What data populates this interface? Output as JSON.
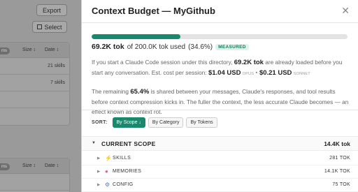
{
  "background": {
    "export_label": "Export",
    "select_label": "Select",
    "panels": [
      {
        "pill": "ms",
        "col_size": "Size ↕",
        "col_date": "Date ↕",
        "rows": [
          "21 skills",
          "7 skills",
          "",
          ""
        ]
      },
      {
        "pill": "ms",
        "col_size": "Size ↕",
        "col_date": "Date ↕",
        "rows": [
          ""
        ]
      }
    ]
  },
  "modal": {
    "title": "Context Budget — MyGithub",
    "close_icon": "close-icon",
    "usage": {
      "used": "69.2K tok",
      "of_text": "of 200.0K tok used",
      "percent_text": "(34.6%)",
      "fraction": 0.346,
      "badge": "MEASURED",
      "bar_color": "#18896c"
    },
    "para1": {
      "a": "If you start a Claude Code session under this directory,",
      "tok": "69.2K tok",
      "b": "are already loaded before you start any conversation. Est. cost per session:",
      "price_opus": "$1.04 USD",
      "opus_label": "OPUS",
      "dot": "·",
      "price_sonnet": "$0.21 USD",
      "sonnet_label": "SONNET"
    },
    "para2": {
      "a": "The remaining",
      "pct": "65.4%",
      "b": "is shared between your messages, Claude's responses, and tool results before context compression kicks in. The fuller the context, the less accurate Claude becomes — an effect known as context rot."
    },
    "sort": {
      "label": "SORT:",
      "options": [
        "By Scope ↓",
        "By Category",
        "By Tokens"
      ]
    },
    "scope": {
      "label": "CURRENT SCOPE",
      "value": "14.4K tok",
      "items": [
        {
          "icon": "lightning-icon",
          "label": "SKILLS",
          "value": "281 TOK"
        },
        {
          "icon": "brain-icon",
          "label": "MEMORIES",
          "value": "14.1K TOK"
        },
        {
          "icon": "gear-icon",
          "label": "CONFIG",
          "value": "75 TOK"
        }
      ]
    }
  }
}
